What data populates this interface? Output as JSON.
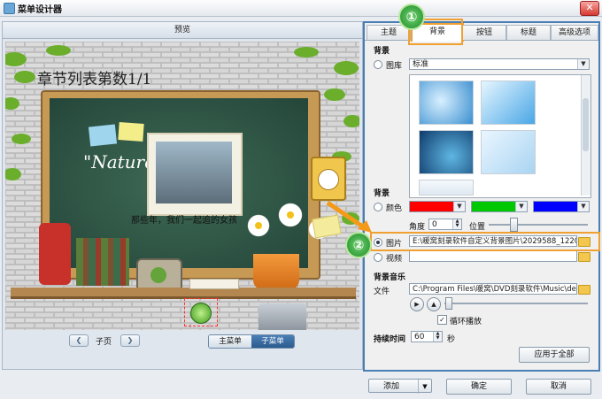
{
  "window": {
    "title": "菜单设计器",
    "close": "✕"
  },
  "preview": {
    "header": "预览",
    "canvas_title": "章节列表第数1/1",
    "nature_text": "\"Nature",
    "caption": "那些年，我们一起追的女孩",
    "nav_label": "子页",
    "menu_tabs": [
      "主菜单",
      "子菜单"
    ]
  },
  "tabs": [
    {
      "label": "主题",
      "active": false
    },
    {
      "label": "背景",
      "active": true
    },
    {
      "label": "按钮",
      "active": false
    },
    {
      "label": "标题",
      "active": false
    },
    {
      "label": "高级选项",
      "active": false
    }
  ],
  "background": {
    "section_label": "背景",
    "gallery_label": "图库",
    "gallery_select": "标准",
    "section_label_2": "背景",
    "color_label": "颜色",
    "colors": [
      "#ff0000",
      "#00c800",
      "#0000ff"
    ],
    "angle_label": "角度",
    "angle_value": "0",
    "position_label": "位置",
    "image_label": "图片",
    "image_path": "E:\\暖窝刻录软件自定义背景图片\\2029588_1220",
    "video_label": "视频",
    "video_path": ""
  },
  "music": {
    "section_label": "背景音乐",
    "file_label": "文件",
    "file_path": "C:\\Program Files\\暖窝\\DVD刻录软件\\Music\\defa",
    "loop_label": "循环播放",
    "loop_checked": true
  },
  "duration": {
    "label": "持续时间",
    "value": "60",
    "unit": "秒"
  },
  "apply_all": "应用于全部",
  "bottom": {
    "add": "添加",
    "ok": "确定",
    "cancel": "取消"
  },
  "badges": [
    "①",
    "②"
  ]
}
